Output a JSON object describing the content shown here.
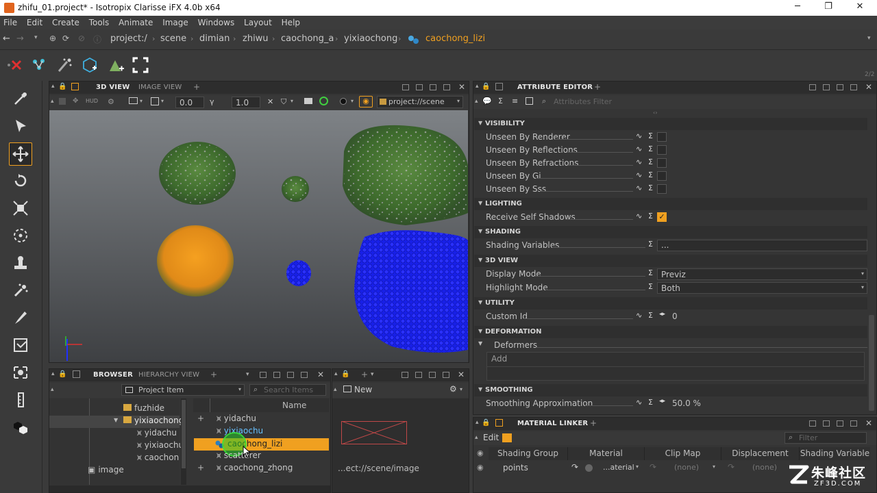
{
  "window": {
    "title": "zhifu_01.project* - Isotropix Clarisse iFX 4.0b x64",
    "controls": {
      "minimize": "─",
      "maximize": "❐",
      "close": "✕"
    }
  },
  "menu": [
    "File",
    "Edit",
    "Create",
    "Tools",
    "Animate",
    "Image",
    "Windows",
    "Layout",
    "Help"
  ],
  "breadcrumb": [
    "project:/",
    "scene",
    "dimian",
    "zhiwu",
    "caochong_a",
    "yixiaochong",
    "caochong_lizi"
  ],
  "toolbar_counter": "2/2",
  "viewport_panel": {
    "tabs": [
      "3D VIEW",
      "IMAGE VIEW"
    ],
    "add": "+",
    "hud": "HUD",
    "value_a": "0.0",
    "value_b": "1.0",
    "path": "project://scene"
  },
  "attribute_editor": {
    "tab": "ATTRIBUTE EDITOR",
    "add": "+",
    "filter_placeholder": "Attributes Filter",
    "sections": {
      "visibility": "VISIBILITY",
      "lighting": "LIGHTING",
      "shading": "SHADING",
      "view3d": "3D VIEW",
      "utility": "UTILITY",
      "deformation": "DEFORMATION",
      "smoothing": "SMOOTHING"
    },
    "rows": {
      "unseen_renderer": "Unseen By Renderer",
      "unseen_reflections": "Unseen By Reflections",
      "unseen_refractions": "Unseen By Refractions",
      "unseen_gi": "Unseen By Gi",
      "unseen_sss": "Unseen By Sss",
      "receive_self_shadows": "Receive Self Shadows",
      "shading_variables": "Shading Variables",
      "shading_variables_value": "...",
      "display_mode": "Display Mode",
      "display_mode_value": "Previz",
      "highlight_mode": "Highlight Mode",
      "highlight_mode_value": "Both",
      "custom_id": "Custom Id",
      "custom_id_value": "0",
      "deformers": "Deformers",
      "deformers_add": "Add",
      "smoothing_approx": "Smoothing Approximation",
      "smoothing_approx_value": "50.0 %"
    }
  },
  "browser": {
    "tabs": [
      "BROWSER",
      "HIERARCHY VIEW"
    ],
    "add": "+",
    "project_item": "Project Item",
    "search_placeholder": "Search Items",
    "tree": [
      "fuzhide",
      "yixiaochong",
      "yidachu",
      "yixiaochu",
      "caochon",
      "image"
    ],
    "column_name": "Name",
    "items": [
      "yidachu",
      "yixiaochu",
      "caochong_lizi",
      "scatterer",
      "caochong_zhong"
    ],
    "plus": "+"
  },
  "preview": {
    "new_label": "New",
    "path": "...ect://scene/image"
  },
  "material_linker": {
    "tab": "MATERIAL LINKER",
    "add": "+",
    "edit": "Edit",
    "filter_placeholder": "Filter",
    "columns": [
      "Shading Group",
      "Material",
      "Clip Map",
      "Displacement",
      "Shading Variable"
    ],
    "row": {
      "group": "points",
      "material": "...aterial",
      "clip_map": "(none)",
      "displacement": "(none)"
    }
  },
  "watermark": {
    "cn": "朱峰社区",
    "url": "ZF3D.COM"
  },
  "colors": {
    "accent_orange": "#f0a020",
    "selection": "#f0a020",
    "viewport_top": "#7e8286",
    "points_blue": "#1a20ff"
  }
}
